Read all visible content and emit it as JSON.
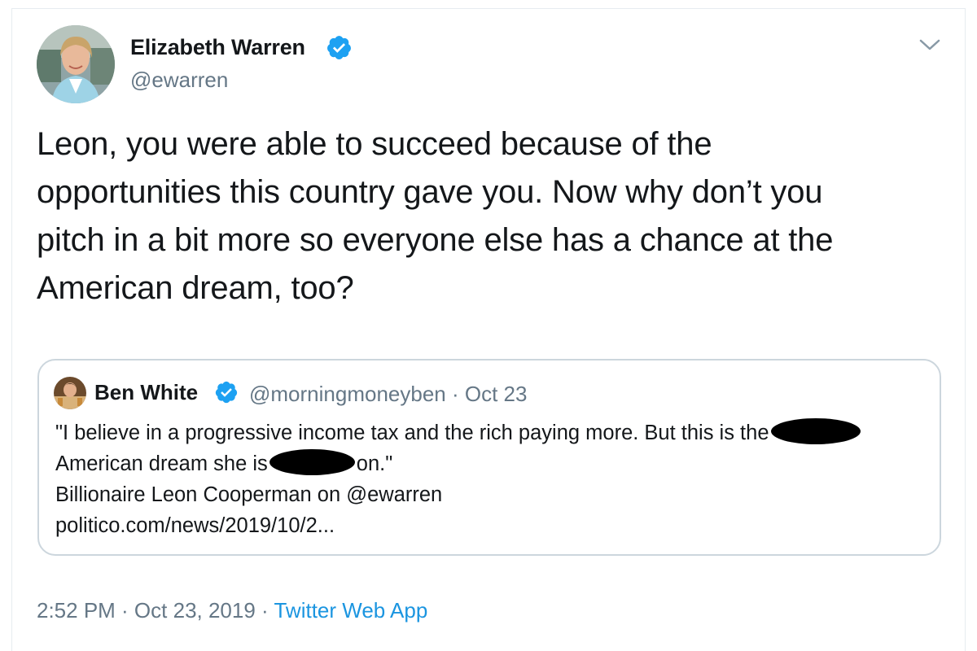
{
  "author": {
    "name": "Elizabeth Warren",
    "handle": "@ewarren",
    "verified": true
  },
  "tweet": {
    "text": "Leon, you were able to succeed because of the\nopportunities this country gave you. Now why don’t you\npitch in a bit more so everyone else has a chance at the\nAmerican dream, too?"
  },
  "quoted": {
    "name": "Ben White",
    "handle_date": "@morningmoneyben · Oct 23",
    "verified": true,
    "line1": "\"I believe in a progressive income tax and the rich paying more. But this is the",
    "line2a": "American dream she is",
    "line2b": "on.\"",
    "line3": "Billionaire Leon Cooperman on @ewarren",
    "line4": "politico.com/news/2019/10/2..."
  },
  "meta": {
    "time_date": "2:52 PM · Oct 23, 2019 ·",
    "source": "Twitter Web App"
  },
  "colors": {
    "verified_blue": "#1da1f2",
    "link_blue": "#1b95e0",
    "secondary_text": "#657786",
    "border": "#ccd6dd"
  },
  "icons": {
    "verified": "verified-badge-icon",
    "caret": "chevron-down-icon"
  }
}
